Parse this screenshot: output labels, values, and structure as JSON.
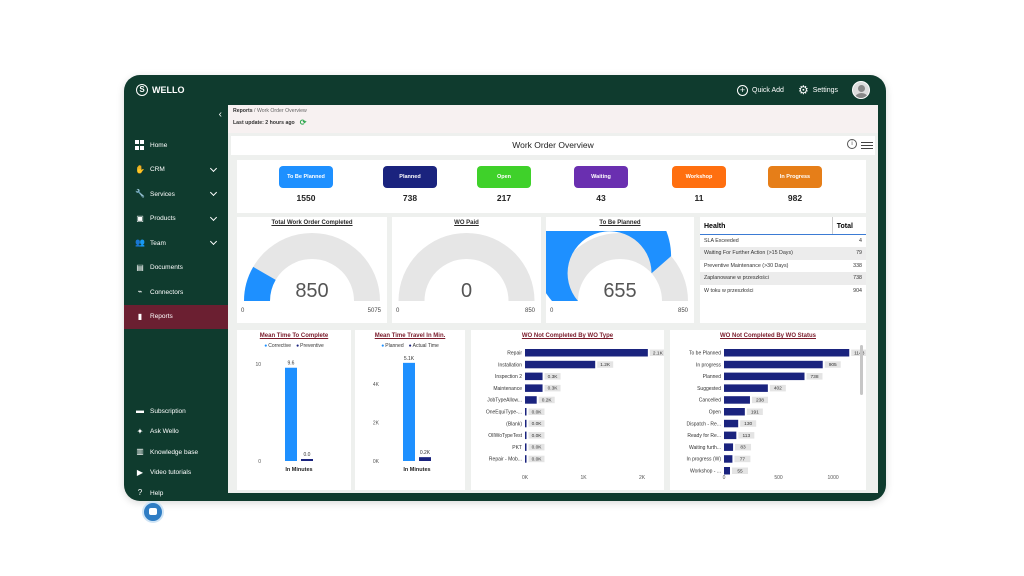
{
  "app": {
    "name": "WELLO"
  },
  "topbar": {
    "quick_add": "Quick Add",
    "settings": "Settings"
  },
  "sidebar": {
    "items": [
      {
        "label": "Home",
        "icon": "home-grid-icon",
        "expandable": false
      },
      {
        "label": "CRM",
        "icon": "handshake-icon",
        "expandable": true
      },
      {
        "label": "Services",
        "icon": "wrench-icon",
        "expandable": true
      },
      {
        "label": "Products",
        "icon": "box-icon",
        "expandable": true
      },
      {
        "label": "Team",
        "icon": "people-icon",
        "expandable": true
      },
      {
        "label": "Documents",
        "icon": "document-icon",
        "expandable": false
      },
      {
        "label": "Connectors",
        "icon": "plug-icon",
        "expandable": false
      },
      {
        "label": "Reports",
        "icon": "bar-chart-icon",
        "expandable": false,
        "active": true
      }
    ],
    "bottom_items": [
      {
        "label": "Subscription",
        "icon": "card-icon"
      },
      {
        "label": "Ask Wello",
        "icon": "chat-icon"
      },
      {
        "label": "Knowledge base",
        "icon": "book-icon"
      },
      {
        "label": "Video tutorials",
        "icon": "play-icon"
      },
      {
        "label": "Help",
        "icon": "help-icon"
      }
    ]
  },
  "breadcrumb": {
    "root": "Reports",
    "separator": " / ",
    "current": "Work Order Overview"
  },
  "last_update": "Last update: 2 hours ago",
  "page_title": "Work Order Overview",
  "statuses": [
    {
      "label": "To Be Planned",
      "count": "1550",
      "color": "#1e90ff"
    },
    {
      "label": "Planned",
      "count": "738",
      "color": "#1a237e"
    },
    {
      "label": "Open",
      "count": "217",
      "color": "#3fd12a"
    },
    {
      "label": "Waiting",
      "count": "43",
      "color": "#6a2fb0"
    },
    {
      "label": "Workshop",
      "count": "11",
      "color": "#ff6f0f"
    },
    {
      "label": "In Progress",
      "count": "982",
      "color": "#e67e18"
    }
  ],
  "gauges": [
    {
      "title": "Total Work Order Completed",
      "value": 850,
      "value_label": "850",
      "min": "0",
      "max": "5075",
      "max_value": 5075
    },
    {
      "title": "WO Paid",
      "value": 0,
      "value_label": "0",
      "min": "0",
      "max": "850",
      "max_value": 850
    },
    {
      "title": "To Be Planned",
      "value": 655,
      "value_label": "655",
      "min": "0",
      "max": "850",
      "max_value": 850
    }
  ],
  "health": {
    "headers": [
      "Health",
      "Total"
    ],
    "rows": [
      {
        "label": "SLA Exceeded",
        "total": "4"
      },
      {
        "label": "Waiting For Further Action (>15 Days)",
        "total": "79"
      },
      {
        "label": "Preventive Maintenance (>30 Days)",
        "total": "338"
      },
      {
        "label": "Zaplanowane w przeszłości",
        "total": "738"
      },
      {
        "label": "W toku w przeszłości",
        "total": "904"
      }
    ]
  },
  "chart_data": [
    {
      "type": "bar",
      "title": "Mean Time To Complete",
      "categories": [
        "In Minutes"
      ],
      "series": [
        {
          "name": "Corrective",
          "values": [
            9.6
          ],
          "color": "#1e90ff"
        },
        {
          "name": "Preventive",
          "values": [
            0.0
          ],
          "color": "#1a237e"
        }
      ],
      "data_labels": [
        "9.6",
        "0.0"
      ],
      "yticks": [
        "0",
        "10"
      ],
      "ylim": [
        0,
        10.5
      ]
    },
    {
      "type": "bar",
      "title": "Mean Time Travel In Min.",
      "categories": [
        "In Minutes"
      ],
      "series": [
        {
          "name": "Planned",
          "values": [
            5100
          ],
          "color": "#1e90ff"
        },
        {
          "name": "Actual Time",
          "values": [
            200
          ],
          "color": "#1a237e"
        }
      ],
      "data_labels": [
        "5.1K",
        "0.2K"
      ],
      "yticks": [
        "0K",
        "2K",
        "4K"
      ],
      "ylim": [
        0,
        5300
      ]
    },
    {
      "type": "bar",
      "orientation": "horizontal",
      "title": "WO Not Completed By WO Type",
      "categories": [
        "Repair",
        "Installation",
        "Inspection 2",
        "Maintenance",
        "JobTypeAllow...",
        "OneEquiType-...",
        "(Blank)",
        "OIlWoTypeTest",
        "PKT",
        "Repair - Mob..."
      ],
      "values": [
        2100,
        1200,
        300,
        300,
        200,
        20,
        10,
        10,
        5,
        5
      ],
      "data_labels": [
        "2.1K",
        "1.2K",
        "0.3K",
        "0.3K",
        "0.2K",
        "0.0K",
        "0.0K",
        "0.0K",
        "0.0K",
        "0.0K"
      ],
      "xticks": [
        "0K",
        "1K",
        "2K"
      ],
      "xlim": [
        0,
        2000
      ],
      "color": "#1a237e"
    },
    {
      "type": "bar",
      "orientation": "horizontal",
      "title": "WO Not Completed By WO Status",
      "categories": [
        "To be Planned",
        "In progress",
        "Planned",
        "Suggested",
        "Cancelled",
        "Open",
        "Dispatch - Re...",
        "Ready for Re...",
        "Waiting furth...",
        "In progress (W)",
        "Workshop - ..."
      ],
      "values": [
        1148,
        905,
        738,
        402,
        238,
        191,
        130,
        113,
        83,
        77,
        55
      ],
      "data_labels": [
        "1148",
        "905",
        "738",
        "402",
        "238",
        "191",
        "130",
        "113",
        "83",
        "77",
        "55"
      ],
      "xticks": [
        "0",
        "500",
        "1000"
      ],
      "xlim": [
        0,
        1100
      ],
      "color": "#1a237e"
    }
  ]
}
